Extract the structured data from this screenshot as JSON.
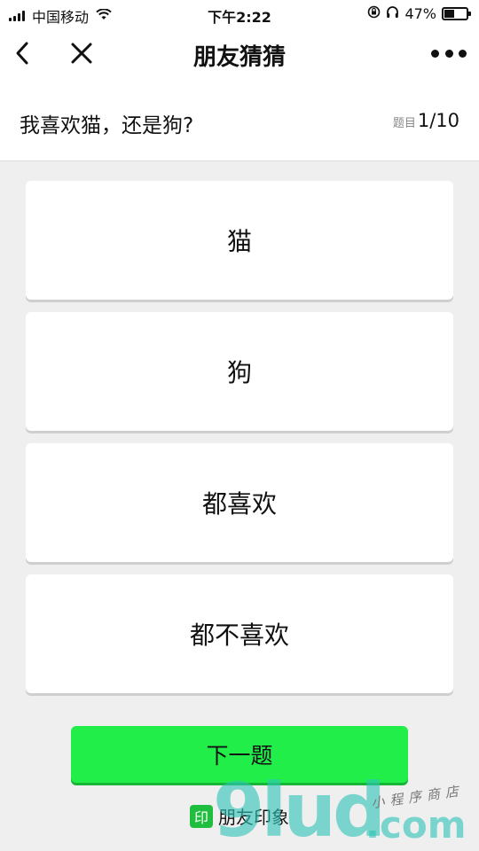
{
  "status_bar": {
    "carrier": "中国移动",
    "time": "下午2:22",
    "battery_percent": "47%",
    "battery_level": 0.47
  },
  "nav": {
    "title": "朋友猜猜"
  },
  "question": {
    "text": "我喜欢猫，还是狗?",
    "progress_label": "题目",
    "progress_value": "1/10"
  },
  "options": [
    {
      "label": "猫"
    },
    {
      "label": "狗"
    },
    {
      "label": "都喜欢"
    },
    {
      "label": "都不喜欢"
    }
  ],
  "next_button": {
    "label": "下一题"
  },
  "brand": {
    "icon_char": "印",
    "name": "朋友印象"
  },
  "watermark": {
    "main": "9lud",
    "domain": ".com",
    "tagline": "小程序商店"
  },
  "colors": {
    "accent_green": "#22ee4a",
    "brand_green": "#1fbe3f",
    "watermark_teal": "#2ec4b6"
  }
}
